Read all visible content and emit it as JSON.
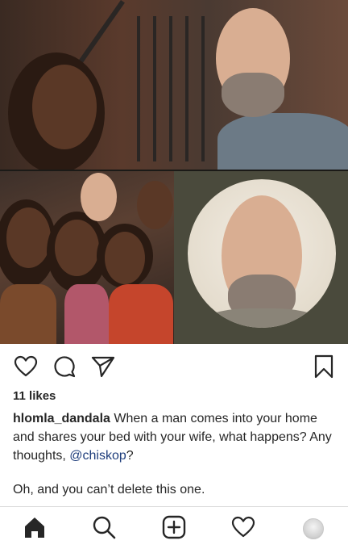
{
  "post": {
    "likes_text": "11 likes",
    "caption": {
      "username": "hlomla_dandala",
      "text_before_mention": " When a man comes into your home and shares your bed with your wife, what happens? Any thoughts, ",
      "mention": "@chiskop",
      "text_after_mention": "?"
    },
    "extra_line": "Oh, and you can’t delete this one."
  },
  "icons": {
    "like": "heart-outline-icon",
    "comment": "comment-bubble-icon",
    "share": "paper-plane-icon",
    "save": "bookmark-icon",
    "home": "home-filled-icon",
    "search": "search-icon",
    "add": "add-post-icon",
    "activity": "heart-outline-icon",
    "profile": "profile-avatar"
  },
  "colors": {
    "text": "#262626",
    "mention": "#1e3d7b",
    "divider": "#dbdbdb"
  }
}
